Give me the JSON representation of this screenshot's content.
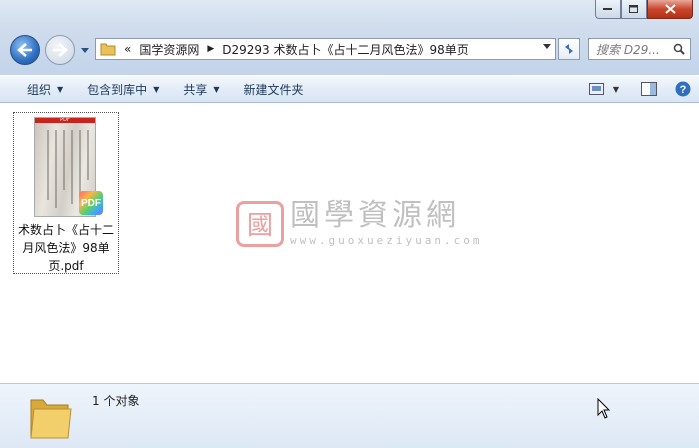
{
  "window": {
    "controls": {
      "minimize": "minimize",
      "maximize": "maximize",
      "close": "close"
    }
  },
  "nav": {
    "overflow": "«",
    "breadcrumb": [
      "国学资源网",
      "D29293 术数占卜《占十二月风色法》98单页"
    ],
    "search_placeholder": "搜索 D29..."
  },
  "toolbar": {
    "organize": "组织",
    "include_in_library": "包含到库中",
    "share": "共享",
    "new_folder": "新建文件夹"
  },
  "files": [
    {
      "name": "术数占卜《占十二月风色法》98单页.pdf",
      "badge": "PDF",
      "thumb_label": "PDF"
    }
  ],
  "watermark": {
    "seal_char": "國",
    "title": "國學資源網",
    "url": "www.guoxueziyuan.com"
  },
  "status": {
    "count_text": "1 个对象"
  },
  "colors": {
    "accent": "#2f6fc0",
    "close": "#c9462c"
  }
}
